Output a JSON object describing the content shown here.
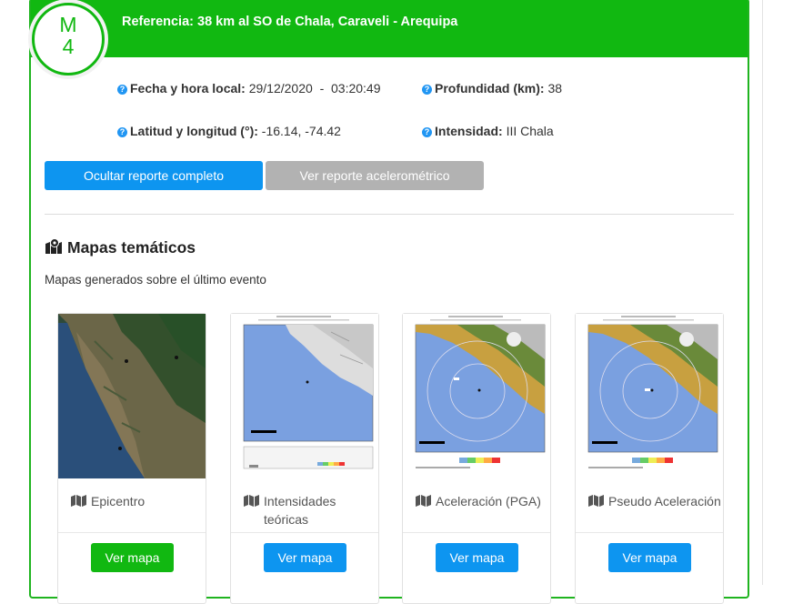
{
  "header": {
    "magnitude_letter": "M",
    "magnitude_value": "4",
    "title": "Referencia: 38 km al SO de Chala, Caraveli - Arequipa"
  },
  "info": {
    "fecha_label": "Fecha y hora local:",
    "fecha_value": "29/12/2020  -  03:20:49",
    "profundidad_label": "Profundidad (km):",
    "profundidad_value": "38",
    "latlon_label": "Latitud y longitud (°):",
    "latlon_value": "-16.14, -74.42",
    "intensidad_label": "Intensidad:",
    "intensidad_value": "III Chala",
    "help_glyph": "?"
  },
  "buttons": {
    "hide_report": "Ocultar reporte completo",
    "accel_report": "Ver reporte acelerométrico"
  },
  "section": {
    "title": "Mapas temáticos",
    "subtitle": "Mapas generados sobre el último evento"
  },
  "maps": [
    {
      "label": "Epicentro",
      "button": "Ver mapa",
      "button_color": "#11b811"
    },
    {
      "label": "Intensidades teóricas",
      "button": "Ver mapa",
      "button_color": "#0d95f0"
    },
    {
      "label": "Aceleración (PGA)",
      "button": "Ver mapa",
      "button_color": "#0d95f0"
    },
    {
      "label": "Pseudo Aceleración",
      "button": "Ver mapa",
      "button_color": "#0d95f0"
    }
  ],
  "colors": {
    "accent_green": "#11b811",
    "accent_blue": "#0d95f0",
    "disabled_grey": "#b2b2b2"
  }
}
